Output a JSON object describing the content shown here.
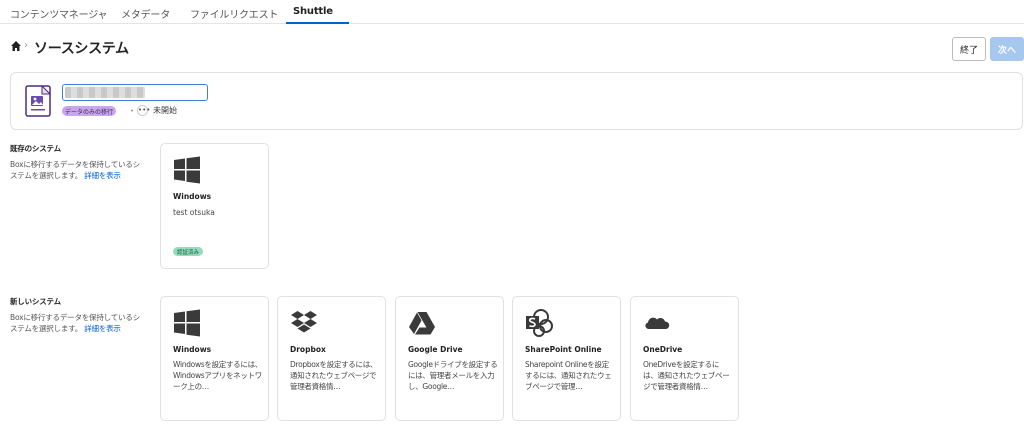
{
  "tabs": [
    {
      "label": "コンテンツマネージャ",
      "active": false
    },
    {
      "label": "メタデータ",
      "active": false
    },
    {
      "label": "ファイルリクエスト",
      "active": false
    },
    {
      "label": "Shuttle",
      "active": true
    }
  ],
  "header": {
    "title": "ソースシステム",
    "end_button": "終了",
    "next_button": "次へ"
  },
  "migration": {
    "name_value": "",
    "badge": "データのみの移行",
    "separator": "•",
    "status_icon": "•••",
    "status": "未開始"
  },
  "existing": {
    "title": "既存のシステム",
    "desc": "Boxに移行するデータを保持しているシステムを選択します。",
    "link": "詳細を表示",
    "cards": [
      {
        "icon": "windows-icon",
        "name": "Windows",
        "sub": "test otsuka",
        "badge": "認証済み"
      }
    ]
  },
  "new_systems": {
    "title": "新しいシステム",
    "desc": "Boxに移行するデータを保持しているシステムを選択します。",
    "link": "詳細を表示",
    "cards": [
      {
        "icon": "windows-icon",
        "name": "Windows",
        "desc": "Windowsを設定するには、Windowsアプリをネットワーク上の…"
      },
      {
        "icon": "dropbox-icon",
        "name": "Dropbox",
        "desc": "Dropboxを設定するには、通知されたウェブページで管理者資格情…"
      },
      {
        "icon": "google-drive-icon",
        "name": "Google Drive",
        "desc": "Googleドライブを設定するには、管理者メールを入力し、Google…"
      },
      {
        "icon": "sharepoint-icon",
        "name": "SharePoint Online",
        "desc": "Sharepoint Onlineを設定するには、通知されたウェブページで管理…"
      },
      {
        "icon": "onedrive-icon",
        "name": "OneDrive",
        "desc": "OneDriveを設定するには、通知されたウェブページで管理者資格情…"
      }
    ]
  },
  "colors": {
    "accent": "#0061d5",
    "next_disabled": "#a7c8ee",
    "badge_purple": "#c9a6ec",
    "badge_green": "#94dcbd",
    "icon_dark": "#3a3a3a"
  }
}
